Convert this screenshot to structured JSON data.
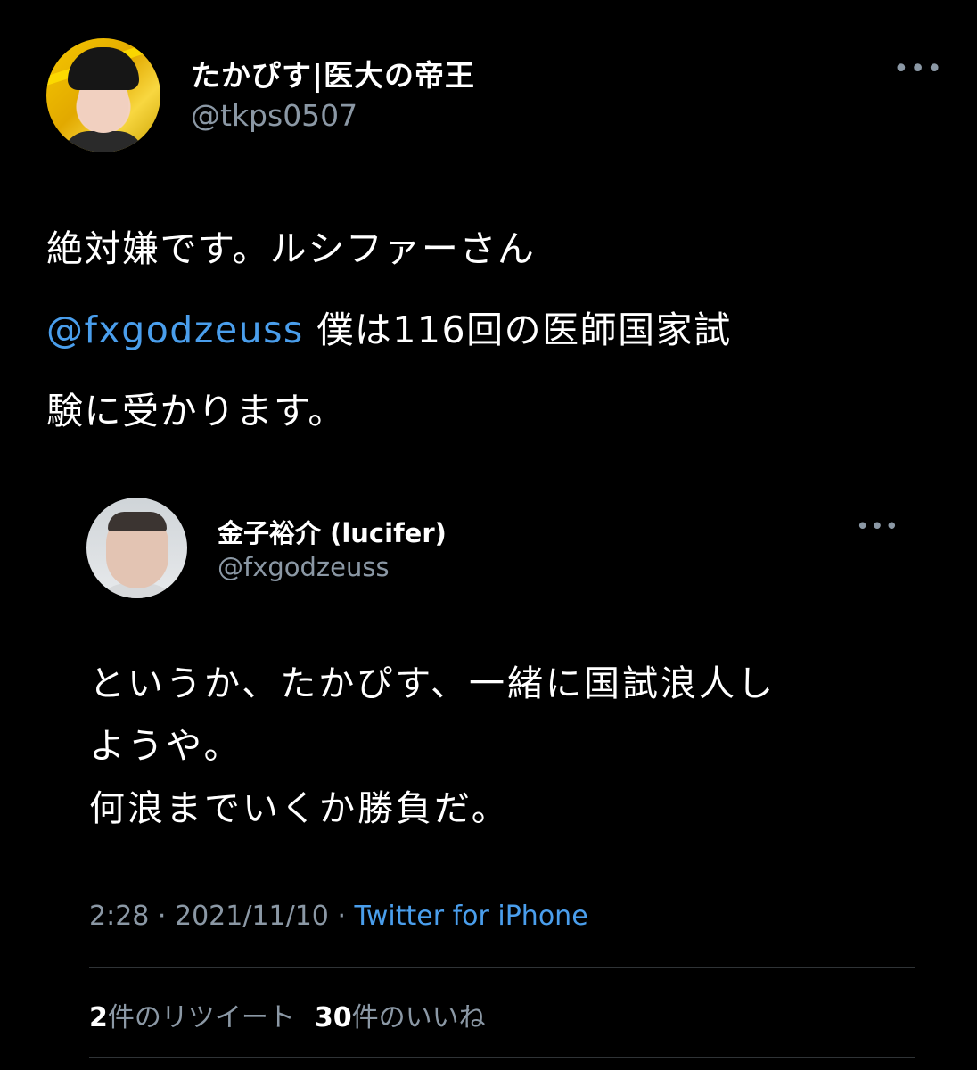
{
  "tweet": {
    "author": {
      "display_name": "たかぴす|医大の帝王",
      "handle": "@tkps0507"
    },
    "more_icon": "more-horizontal-icon",
    "lines": [
      {
        "text": "絶対嫌です。ルシファーさん"
      },
      {
        "mention": "@fxgodzeuss",
        "text": " 僕は116回の医師国家試"
      },
      {
        "text": "験に受かります。"
      }
    ]
  },
  "quoted_tweet": {
    "author": {
      "display_name": "金子裕介 (lucifer)",
      "handle": "@fxgodzeuss"
    },
    "more_icon": "more-horizontal-icon",
    "lines": [
      "というか、たかぴす、一緒に国試浪人し",
      "ようや。",
      "何浪までいくか勝負だ。"
    ]
  },
  "meta": {
    "time": "2:28",
    "separator": " · ",
    "date": "2021/11/10",
    "source": "Twitter for iPhone"
  },
  "stats": {
    "retweets_count": "2",
    "retweets_label": "件のリツイート",
    "likes_count": "30",
    "likes_label": "件のいいね"
  },
  "colors": {
    "background": "#000000",
    "text": "#ffffff",
    "secondary": "#8b98a5",
    "link": "#4a9eec"
  }
}
